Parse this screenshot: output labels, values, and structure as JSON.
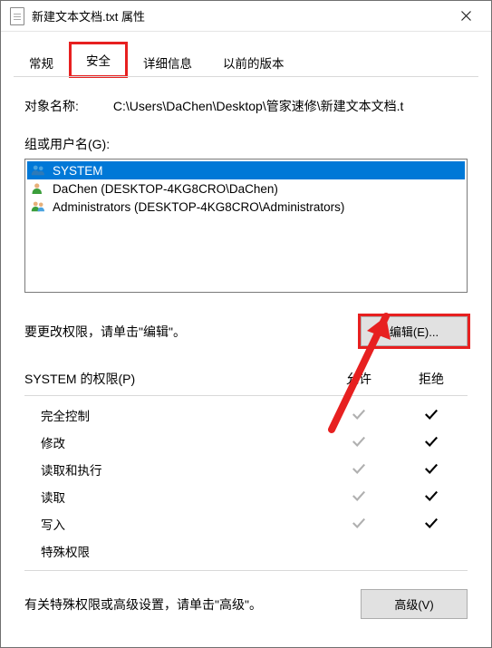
{
  "titlebar": {
    "title": "新建文本文档.txt 属性"
  },
  "tabs": {
    "general": "常规",
    "security": "安全",
    "details": "详细信息",
    "previous": "以前的版本"
  },
  "obj": {
    "label": "对象名称:",
    "value": "C:\\Users\\DaChen\\Desktop\\管家速修\\新建文本文档.t"
  },
  "groups": {
    "label": "组或用户名(G):",
    "items": [
      {
        "name": "SYSTEM"
      },
      {
        "name": "DaChen (DESKTOP-4KG8CRO\\DaChen)"
      },
      {
        "name": "Administrators (DESKTOP-4KG8CRO\\Administrators)"
      }
    ]
  },
  "edit": {
    "text": "要更改权限，请单击\"编辑\"。",
    "button": "编辑(E)..."
  },
  "perm": {
    "header_label": "SYSTEM 的权限(P)",
    "col_allow": "允许",
    "col_deny": "拒绝",
    "rows": {
      "full": "完全控制",
      "modify": "修改",
      "readexec": "读取和执行",
      "read": "读取",
      "write": "写入",
      "special": "特殊权限"
    }
  },
  "advanced": {
    "text": "有关特殊权限或高级设置，请单击\"高级\"。",
    "button": "高级(V)"
  }
}
